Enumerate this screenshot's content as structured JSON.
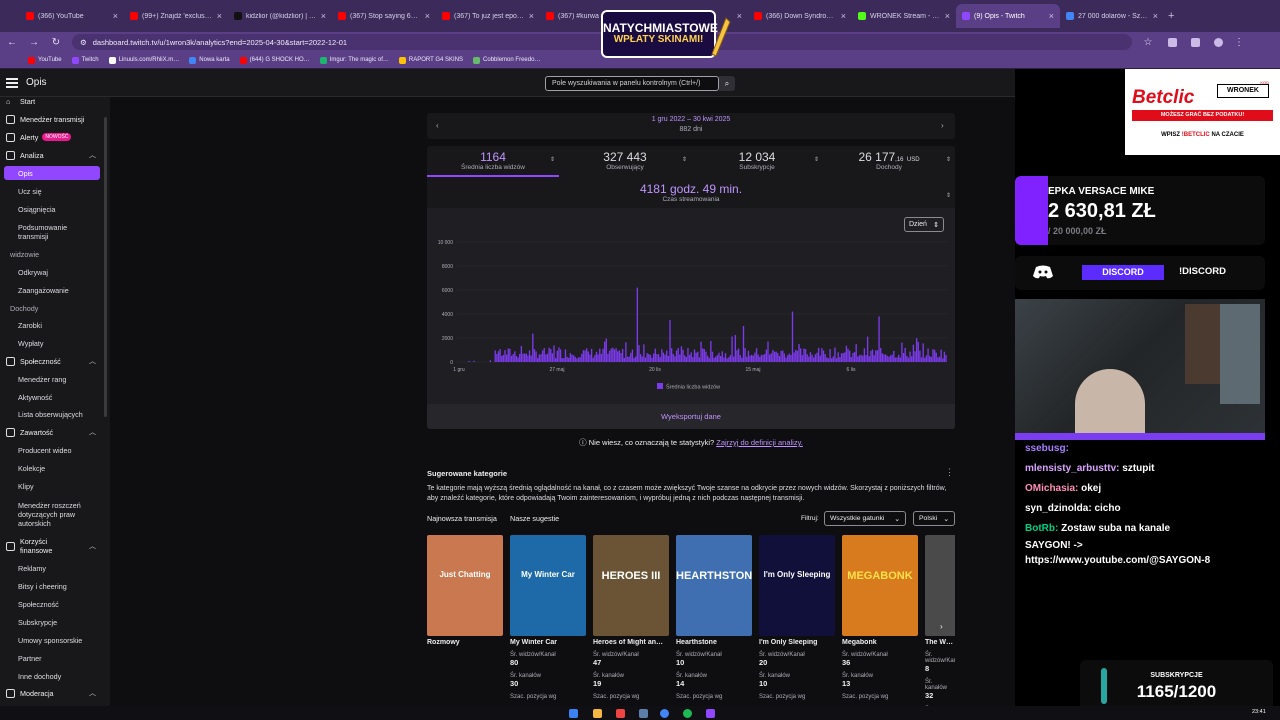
{
  "browser": {
    "tabs": [
      {
        "title": "(366) YouTube",
        "color": "#ff0000"
      },
      {
        "title": "(99+) Znajdź 'exclusiveltin…",
        "color": "#ff0000"
      },
      {
        "title": "kidzlior (@kidzlior) | TikTo…",
        "color": "#111111"
      },
      {
        "title": "(367) Stop saying 67 It is…",
        "color": "#ff0000"
      },
      {
        "title": "(367) To już jest epoka lod…",
        "color": "#ff0000"
      },
      {
        "title": "(367) #kurwa #…",
        "color": "#ff0000"
      },
      {
        "title": "…strea…",
        "color": "#ff0000"
      },
      {
        "title": "(366) Down Syndrome mu…",
        "color": "#ff0000"
      },
      {
        "title": "WRONEK Stream - Watch…",
        "color": "#53fc18"
      },
      {
        "title": "(9) Opis - Twitch",
        "color": "#9147ff"
      },
      {
        "title": "27 000 dolarów - Szukaj g…",
        "color": "#4285f4"
      }
    ],
    "url": "dashboard.twitch.tv/u/1wron3k/analytics?end=2025-04-30&start=2022-12-01",
    "bookmarks": [
      {
        "label": "YouTube",
        "color": "#ff0000"
      },
      {
        "label": "Twitch",
        "color": "#9147ff"
      },
      {
        "label": "Linuuls.com/RhliX.m…",
        "color": "#ffffff"
      },
      {
        "label": "Nowa karta",
        "color": "#4285f4"
      },
      {
        "label": "(644) G SHOCK HO…",
        "color": "#ff0000"
      },
      {
        "label": "Imgur: The magic of…",
        "color": "#1bb76e"
      },
      {
        "label": "RAPORT G4 SKINS",
        "color": "#ffc107"
      },
      {
        "label": "Cobblemon Freedo…",
        "color": "#66bb6a"
      }
    ]
  },
  "dashboard": {
    "title": "Opis",
    "search_placeholder": "Pole wyszukiwania w panelu kontrolnym (Ctrl+/)"
  },
  "sidebar": {
    "start": "Start",
    "stream_manager": "Menedżer transmisji",
    "alerts": "Alerty",
    "alerts_badge": "NOWOŚĆ",
    "analytics": "Analiza",
    "overview": "Opis",
    "learn": "Ucz się",
    "achievements": "Osiągnięcia",
    "stream_summary": "Podsumowanie transmisji",
    "viewers_section": "widzowie",
    "discovery": "Odkrywaj",
    "engagement": "Zaangażowanie",
    "revenue_section": "Dochody",
    "earnings": "Zarobki",
    "payouts": "Wypłaty",
    "community": "Społeczność",
    "roles_manager": "Menedżer rang",
    "activity": "Aktywność",
    "followers_list": "Lista obserwujących",
    "content": "Zawartość",
    "video_producer": "Producent wideo",
    "collections": "Kolekcje",
    "clips": "Klipy",
    "copyright_manager": "Menedżer roszczeń dotyczących praw autorskich",
    "financial_benefits": "Korzyści finansowe",
    "ads": "Reklamy",
    "bits": "Bitsy i cheering",
    "community2": "Społeczność",
    "subscriptions": "Subskrypcje",
    "sponsorship": "Umowy sponsorskie",
    "partner": "Partner",
    "other_revenue": "Inne dochody",
    "moderation": "Moderacja"
  },
  "analytics": {
    "date_range": "1 gru 2022 – 30 kwi 2025",
    "days": "882 dni",
    "kpis": [
      {
        "value": "1164",
        "label": "Średnia liczba widzów"
      },
      {
        "value": "327 443",
        "label": "Obserwujący"
      },
      {
        "value": "12 034",
        "label": "Subskrypcje"
      },
      {
        "value": "26 177",
        "cents": ",16",
        "currency": "USD",
        "label": "Dochody"
      }
    ],
    "hours_value": "4181 godz. 49 min.",
    "hours_label": "Czas streamowania",
    "granularity": "Dzień",
    "export": "Wyeksportuj dane",
    "help_text": "Nie wiesz, co oznaczają te statystyki?",
    "help_link": "Zajrzyj do definicji analizy."
  },
  "chart_data": {
    "type": "bar",
    "series": [
      {
        "name": "Średnia liczba widzów",
        "color": "#7c3aed"
      }
    ],
    "x_tick_labels": [
      "1 gru",
      "27 maj",
      "20 lis",
      "15 maj",
      "6 lis"
    ],
    "y_ticks": [
      0,
      2000,
      4000,
      6000,
      8000,
      10000
    ],
    "y_tick_labels": [
      "0",
      "2000",
      "4000",
      "6000",
      "8000",
      "10 000"
    ],
    "ylim": [
      0,
      10000
    ],
    "peak_values": [
      6200,
      4200,
      3800,
      3500,
      3000
    ],
    "grid": true,
    "legend": "bottom"
  },
  "suggested": {
    "title": "Sugerowane kategorie",
    "desc": "Te kategorie mają wyższą średnią oglądalność na kanał, co z czasem może zwiększyć Twoje szanse na odkrycie przez nowych widzów. Skorzystaj z poniższych filtrów, aby znaleźć kategorie, które odpowiadają Twoim zainteresowaniom, i wypróbuj jedną z nich podczas następnej transmisji.",
    "tab_latest": "Najnowsza transmisja",
    "tab_suggestions": "Nasze sugestie",
    "filter_label": "Filtruj:",
    "filter_genre": "Wszystkie gatunki",
    "filter_lang": "Polski",
    "viewers_label": "Śr. widzów/Kanał",
    "channels_label": "Śr. kanałów",
    "position_label": "Szac. pozycja wg",
    "cards": [
      {
        "name": "Rozmowy",
        "art": "Just Chatting",
        "viewers": "",
        "channels": "",
        "bg": "#c9784f"
      },
      {
        "name": "My Winter Car",
        "art": "My Winter Car",
        "viewers": "80",
        "channels": "30",
        "bg": "#1e6aa8"
      },
      {
        "name": "Heroes of Might an…",
        "art": "HEROES III",
        "viewers": "47",
        "channels": "19",
        "bg": "#6b5435"
      },
      {
        "name": "Hearthstone",
        "art": "HEARTHSTONE",
        "viewers": "10",
        "channels": "14",
        "bg": "#3f6fb0"
      },
      {
        "name": "I'm Only Sleeping",
        "art": "I'm Only Sleeping",
        "viewers": "20",
        "channels": "10",
        "bg": "#10103a"
      },
      {
        "name": "Megabonk",
        "art": "MEGABONK",
        "viewers": "36",
        "channels": "13",
        "bg": "#d87a1e"
      },
      {
        "name": "The W…",
        "art": "",
        "viewers": "8",
        "channels": "32",
        "bg": "#4a4a4a"
      }
    ]
  },
  "overlay": {
    "betclic_logo": "Betclic",
    "betclic_kod_label": "KOD",
    "betclic_kod": "WRONEK",
    "betclic_strip": "MOŻESZ GRAĆ BEZ PODATKU!",
    "betclic_wpisz": "WPISZ",
    "betclic_brand": "BETCLIC",
    "betclic_tail": "NA CZACIE",
    "goal_name": "EPKA VERSACE MIKE",
    "goal_value": "2 630,81 ZŁ",
    "goal_target": "/ 20 000,00 ZŁ",
    "discord_btn": "DISCORD",
    "discord_cmd": "!DISCORD",
    "promo_a": "NATYCHMIASTOWE",
    "promo_b": "WPŁATY SKINAMI!",
    "sub_label": "SUBSKRYPCJE",
    "sub_value": "1165/1200",
    "chat": [
      {
        "user": "ssebusg:",
        "text": "",
        "color": "#a87cff"
      },
      {
        "user": "mlensisty_arbusttv:",
        "text": "sztupit",
        "color": "#d9a3ff"
      },
      {
        "user": "OMichasia:",
        "text": "okej",
        "color": "#ff8fb8"
      },
      {
        "user": "syn_dzinolda:",
        "text": "cicho",
        "color": "#ffffff"
      },
      {
        "user": "BotRb:",
        "text": "Zostaw suba na kanale",
        "color": "#00d084"
      },
      {
        "user": "",
        "text": "SAYGON! ->",
        "color": "#ffffff"
      },
      {
        "user": "",
        "text": "https://www.youtube.com/@SAYGON-8",
        "color": "#ffffff"
      }
    ]
  },
  "taskbar": {
    "clock": "23:41"
  }
}
